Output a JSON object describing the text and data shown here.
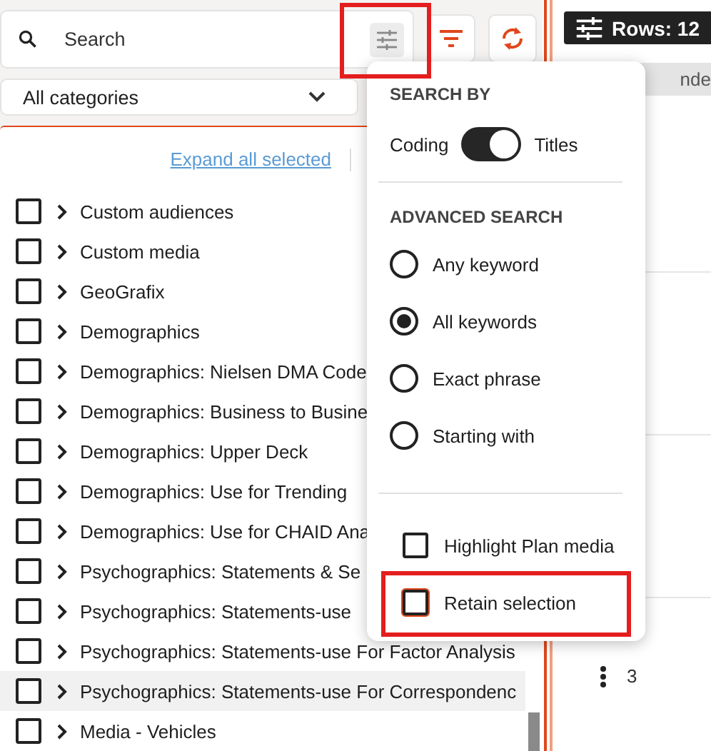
{
  "search": {
    "placeholder": "Search"
  },
  "category_select": {
    "value": "All categories"
  },
  "expand_link": "Expand all selected",
  "categories": [
    {
      "label": "Custom audiences",
      "checked": false,
      "selected": false
    },
    {
      "label": "Custom media",
      "checked": false,
      "selected": false
    },
    {
      "label": "GeoGrafix",
      "checked": false,
      "selected": false
    },
    {
      "label": "Demographics",
      "checked": false,
      "selected": false
    },
    {
      "label": "Demographics: Nielsen DMA Code",
      "checked": false,
      "selected": false
    },
    {
      "label": "Demographics: Business to Busine",
      "checked": false,
      "selected": false
    },
    {
      "label": "Demographics: Upper Deck",
      "checked": false,
      "selected": false
    },
    {
      "label": "Demographics: Use for Trending",
      "checked": false,
      "selected": false
    },
    {
      "label": "Demographics: Use for CHAID Ana",
      "checked": false,
      "selected": false
    },
    {
      "label": "Psychographics: Statements & Se",
      "checked": false,
      "selected": false
    },
    {
      "label": "Psychographics: Statements-use",
      "checked": false,
      "selected": false
    },
    {
      "label": "Psychographics: Statements-use For Factor Analysis",
      "checked": false,
      "selected": false
    },
    {
      "label": "Psychographics: Statements-use For Correspondenc",
      "checked": false,
      "selected": true
    },
    {
      "label": "Media - Vehicles",
      "checked": false,
      "selected": false
    }
  ],
  "rows_button": "Rows: 12",
  "table": {
    "column_1": "nde",
    "row_count": "3"
  },
  "search_popup": {
    "search_by": {
      "heading": "SEARCH BY",
      "left_label": "Coding",
      "right_label": "Titles",
      "on": true
    },
    "advanced": {
      "heading": "ADVANCED SEARCH",
      "options": [
        {
          "label": "Any keyword",
          "selected": false
        },
        {
          "label": "All keywords",
          "selected": true
        },
        {
          "label": "Exact phrase",
          "selected": false
        },
        {
          "label": "Starting with",
          "selected": false
        }
      ]
    },
    "options": [
      {
        "label": "Highlight Plan media",
        "checked": false,
        "focused": false
      },
      {
        "label": "Retain selection",
        "checked": false,
        "focused": true
      }
    ]
  }
}
